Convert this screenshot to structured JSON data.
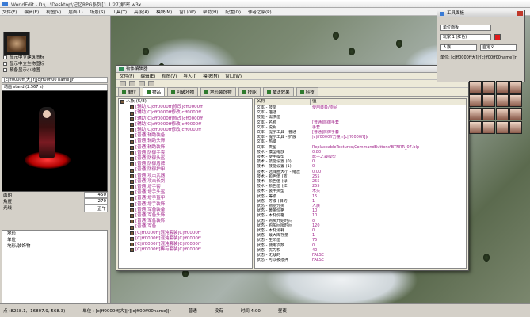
{
  "window": {
    "title": "WorldEdit - D:\\...\\Desktop\\记忆RPG系列[1.1.27]解密.w3x"
  },
  "menu": [
    "文件(F)",
    "编辑(E)",
    "视图(V)",
    "层面(L)",
    "场景(S)",
    "工具(T)",
    "高级(A)",
    "模块(M)",
    "窗口(W)",
    "帮助(H)",
    "配置(O)",
    "作者之家(P)"
  ],
  "left_panel": {
    "checks": [
      "显示中立建筑图标",
      "显示中立生物图标",
      "预备显示小地图"
    ],
    "field_label": "[c|ff0000ff[大]|r][c|ff00ff00 name]|r",
    "preview_label": "动画 stand (2.567 s)",
    "stats": [
      {
        "label": "面朝",
        "value": "450"
      },
      {
        "label": "角度",
        "value": "270"
      },
      {
        "label": "光线",
        "value": "正午"
      }
    ],
    "tree_items": [
      "地形",
      "单位",
      "地形/装饰物"
    ]
  },
  "status_bar": [
    "点 (8258.1, -16807.9, 568.3)",
    "单位 : [c|ff0000ff[大]|r][c|ff00ff00name]|r",
    "普通",
    "没有",
    "时间 4:00",
    "昼夜"
  ],
  "object_editor": {
    "title": "物体编辑器",
    "menu": [
      "文件(F)",
      "编辑(E)",
      "视图(V)",
      "导入(I)",
      "模块(M)",
      "窗口(W)"
    ],
    "tabs": [
      "单位",
      "物品",
      "可破坏物",
      "地形装饰物",
      "技能",
      "魔法效果",
      "科技"
    ],
    "active_tab": 1,
    "tree": [
      "人族 (5/8)",
      "[辅助]C|cff0000ff|修改|cff0000ff",
      "[辅助]C|cff0000ff修改|cff0000ff",
      "[辅助]C|cff0000ff|修改|cff0000ff",
      "[辅助]C|cff0000ff修改|cff0000ff",
      "[辅助]C|cff0000ff修改|cff0000ff",
      "[普通]辅助装备",
      "[普通]辅助头饰",
      "[普通]辅助装饰",
      "[普通]防御手套",
      "[普通]防御头盔",
      "[普通]防御盾牌",
      "[普通]防御护甲",
      "[普通]攻击武器",
      "[普通]攻击长剑",
      "[普通]增手套",
      "[普通]增手头盔",
      "[普通]增手盔甲",
      "[普通]增手装饰",
      "[普通]军备装备",
      "[普通]军备头饰",
      "[普通]军备装饰",
      "[普通]军备",
      "[C|ff0000ff]混沌套装|C|ff0000ff",
      "[C|ff0000ff]混沌套装|C|ff0000ff",
      "[C|ff0000ff]混沌套装|C|ff0000ff",
      "[C|ff0000ff]稀有套装|C|ff0000ff"
    ],
    "grid_headers": [
      "名称",
      "值"
    ],
    "grid": [
      [
        "文本 - 技能",
        "使用装备/物品"
      ],
      [
        "文本 - 描述",
        ""
      ],
      [
        "技能 - 需求值",
        ""
      ],
      [
        "文本 - 名称",
        "[普通]防御手套"
      ],
      [
        "文本 - 说明",
        "手套"
      ],
      [
        "文本 - 提示工具 - 普通",
        "[普通]防御手套"
      ],
      [
        "文本 - 提示工具 - 扩展",
        "|c|ff0000ff力量|r[c|ff0000ff]|r"
      ],
      [
        "文本 - 热键",
        ""
      ],
      [
        "文本 - 类型",
        "ReplaceableTextures\\CommandButtons\\BTNRR_07.blp"
      ],
      [
        "技术 - 模型缩放",
        "0.80"
      ],
      [
        "技术 - 使用模型",
        "影子之袋模型"
      ],
      [
        "技术 - 技能设置 (0)",
        "0"
      ],
      [
        "技术 - 技能设置 (1)",
        "0"
      ],
      [
        "技术 - 选择圈大小 - 缩放",
        "0.00"
      ],
      [
        "技术 - 颜色值 (蓝)",
        "255"
      ],
      [
        "技术 - 颜色值 (绿)",
        "255"
      ],
      [
        "技术 - 颜色值 (红)",
        "255"
      ],
      [
        "技术 - 装甲类型",
        "木头"
      ],
      [
        "状态 - 等级",
        "15"
      ],
      [
        "状态 - 等级 (旧的)",
        "1"
      ],
      [
        "状态 - 物品分类",
        "人族"
      ],
      [
        "状态 - 黄金价格",
        "10"
      ],
      [
        "状态 - 木材价格",
        "10"
      ],
      [
        "状态 - 购买开始时间",
        "0"
      ],
      [
        "状态 - 购买间隔时间",
        "120"
      ],
      [
        "状态 - 木材消耗",
        "0"
      ],
      [
        "状态 - 最大库存量",
        "1"
      ],
      [
        "状态 - 生命值",
        "75"
      ],
      [
        "状态 - 使用次数",
        "0"
      ],
      [
        "状态 - 优先权",
        "40"
      ],
      [
        "状态 - 无敌的",
        "FALSE"
      ],
      [
        "状态 - 可以被抵押",
        "FALSE"
      ]
    ]
  },
  "tool_panel": {
    "title": "工具面板",
    "dropdown1": "单位面板",
    "dropdown2": "玩家 1 (红色)",
    "dropdown3": "人族",
    "dropdown4": "自定义",
    "unit_label": "单位: [c|ff0000ff大]|r[c|ff00ff00name]|r"
  },
  "colors": {
    "accent": "#a0238a",
    "player_red": "#e01b1b"
  }
}
